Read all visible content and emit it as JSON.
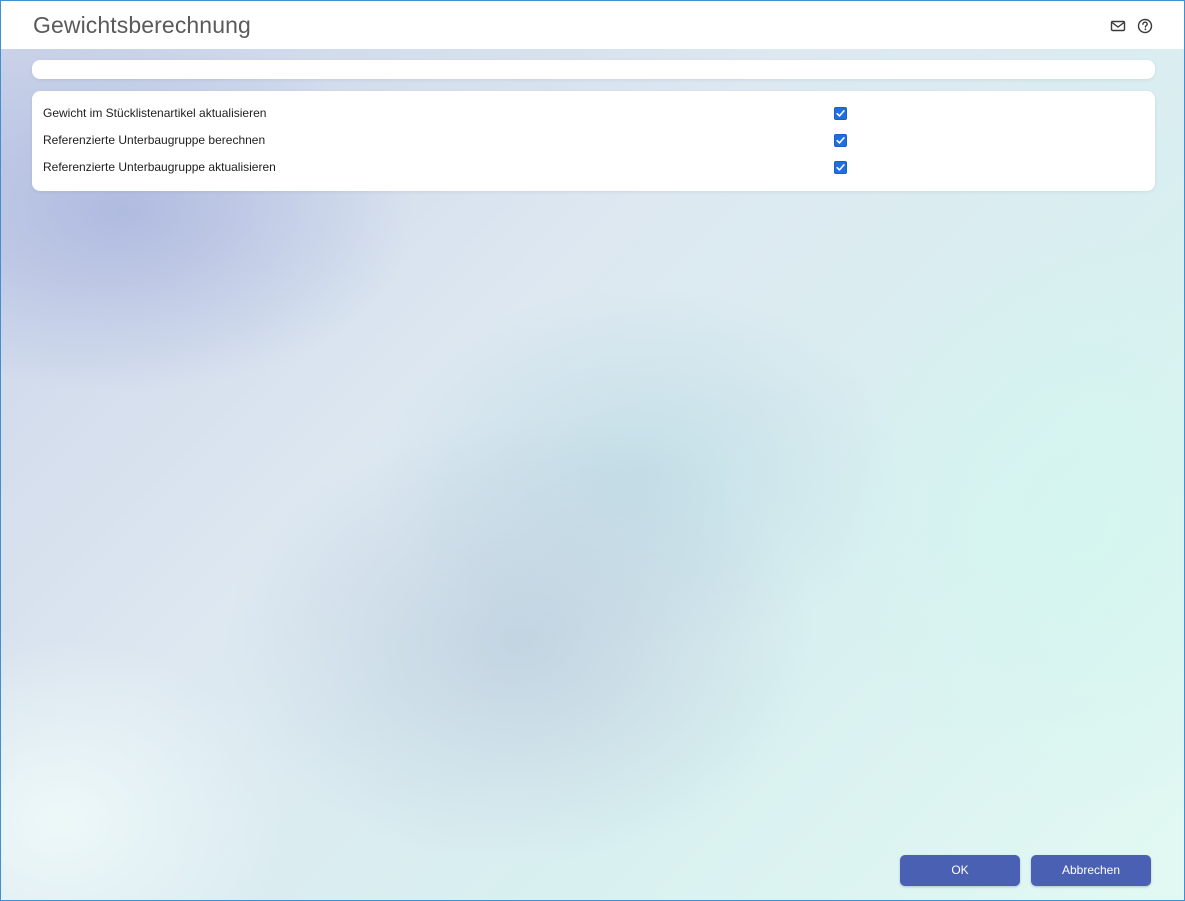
{
  "window": {
    "title": "Gewichtsberechnung"
  },
  "header_icons": {
    "mail": "mail-icon",
    "help": "help-icon"
  },
  "options": [
    {
      "label": "Gewicht im Stücklistenartikel aktualisieren",
      "checked": true
    },
    {
      "label": "Referenzierte Unterbaugruppe berechnen",
      "checked": true
    },
    {
      "label": "Referenzierte Unterbaugruppe aktualisieren",
      "checked": true
    }
  ],
  "buttons": {
    "ok": "OK",
    "cancel": "Abbrechen"
  },
  "colors": {
    "accent": "#4a60b3",
    "checkbox": "#1f6fe0",
    "frame": "#3f8fd2"
  }
}
